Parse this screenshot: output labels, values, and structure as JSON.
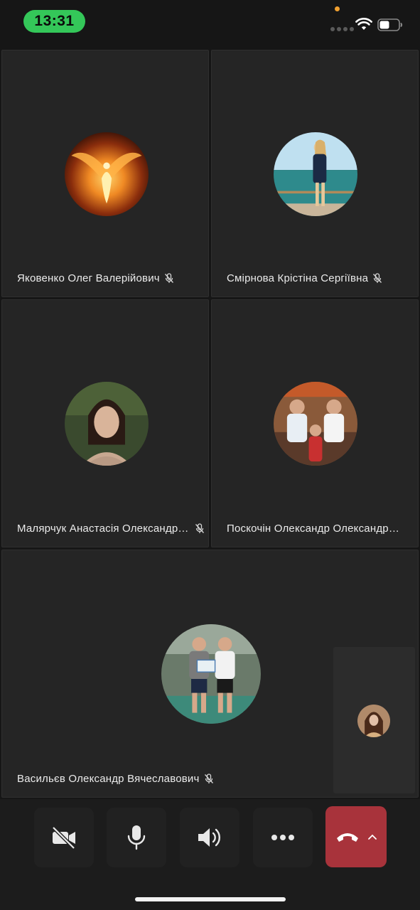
{
  "status_bar": {
    "time": "13:31",
    "time_pill_color": "#34c759",
    "icons": [
      "privacy-indicator-dot",
      "cellular-signal-icon",
      "wifi-icon",
      "battery-icon"
    ]
  },
  "participants": [
    {
      "name": "Яковенко Олег Валерійович",
      "mic_muted": true,
      "avatar": "phoenix-fire-image"
    },
    {
      "name": "Смірнова Крістіна Сергіївна",
      "mic_muted": true,
      "avatar": "woman-by-sea-photo"
    },
    {
      "name": "Малярчук Анастасія Олександрівна",
      "mic_muted": true,
      "avatar": "young-woman-portrait-photo"
    },
    {
      "name": "Поскочін Олександр Олександрович",
      "mic_muted": false,
      "avatar": "group-boxing-gym-photo"
    },
    {
      "name": "Васильєв Олександр Вячеславович",
      "mic_muted": true,
      "avatar": "two-men-certificate-photo"
    }
  ],
  "self_view": {
    "avatar": "self-avatar-photo"
  },
  "controls": {
    "camera": {
      "icon": "camera-off-icon",
      "state": "off"
    },
    "microphone": {
      "icon": "microphone-icon",
      "state": "on"
    },
    "speaker": {
      "icon": "speaker-icon",
      "state": "on"
    },
    "more": {
      "icon": "more-horizontal-icon"
    },
    "end_call": {
      "icon": "end-call-icon",
      "secondary_icon": "chevron-up-icon",
      "color": "#a8333b"
    }
  }
}
